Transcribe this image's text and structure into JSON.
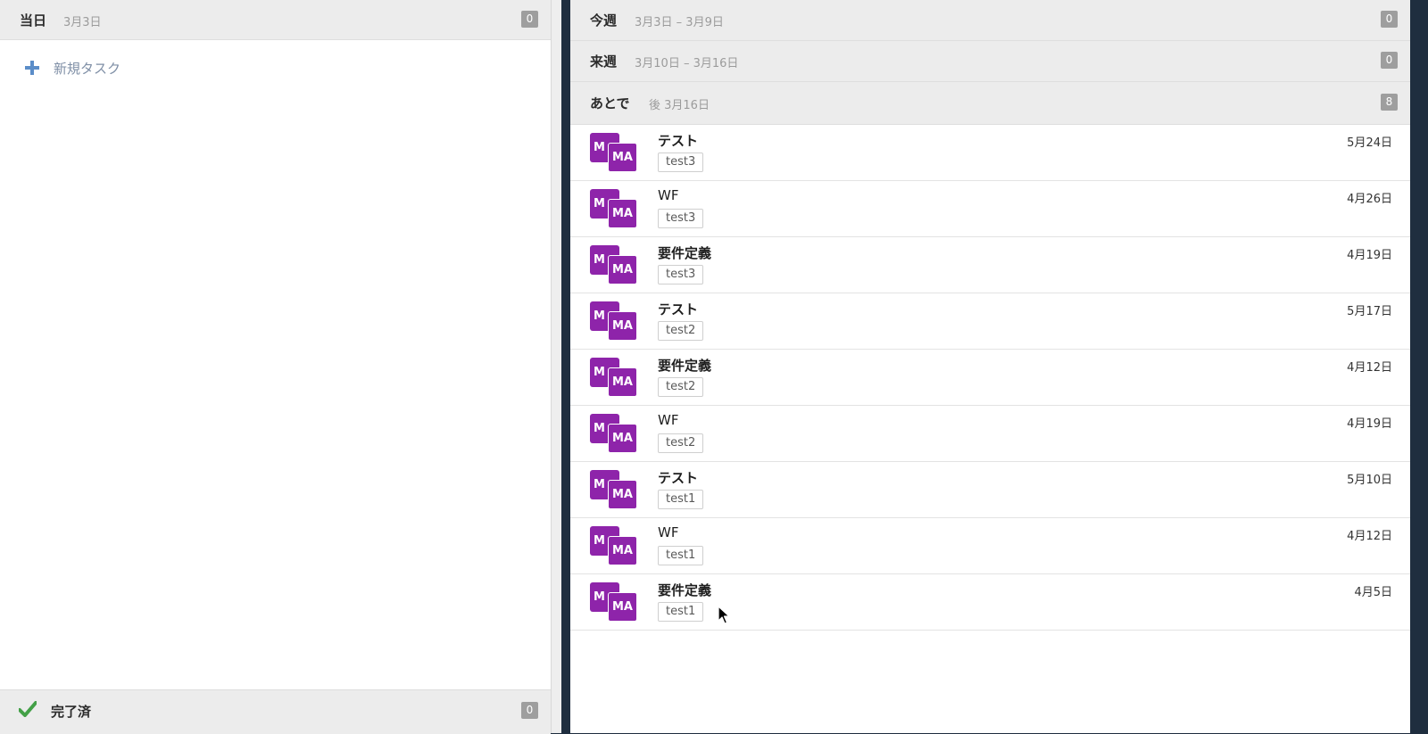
{
  "today": {
    "title": "当日",
    "date": "3月3日",
    "count": "0",
    "new_task_label": "新規タスク"
  },
  "done": {
    "title": "完了済",
    "count": "0"
  },
  "this_week": {
    "title": "今週",
    "range": "3月3日 – 3月9日",
    "count": "0"
  },
  "next_week": {
    "title": "来週",
    "range": "3月10日 – 3月16日",
    "count": "0"
  },
  "later": {
    "title": "あとで",
    "range": "後 3月16日",
    "count": "8"
  },
  "tasks": [
    {
      "title": "テスト",
      "project": "test3",
      "due": "5月24日",
      "avatar_back": "M",
      "avatar_front": "MA"
    },
    {
      "title": "WF",
      "project": "test3",
      "due": "4月26日",
      "avatar_back": "M",
      "avatar_front": "MA"
    },
    {
      "title": "要件定義",
      "project": "test3",
      "due": "4月19日",
      "avatar_back": "M",
      "avatar_front": "MA"
    },
    {
      "title": "テスト",
      "project": "test2",
      "due": "5月17日",
      "avatar_back": "M",
      "avatar_front": "MA"
    },
    {
      "title": "要件定義",
      "project": "test2",
      "due": "4月12日",
      "avatar_back": "M",
      "avatar_front": "MA"
    },
    {
      "title": "WF",
      "project": "test2",
      "due": "4月19日",
      "avatar_back": "M",
      "avatar_front": "MA"
    },
    {
      "title": "テスト",
      "project": "test1",
      "due": "5月10日",
      "avatar_back": "M",
      "avatar_front": "MA"
    },
    {
      "title": "WF",
      "project": "test1",
      "due": "4月12日",
      "avatar_back": "M",
      "avatar_front": "MA"
    },
    {
      "title": "要件定義",
      "project": "test1",
      "due": "4月5日",
      "avatar_back": "M",
      "avatar_front": "MA"
    }
  ],
  "colors": {
    "avatar": "#8e24aa",
    "accent": "#5b8dc8",
    "check": "#43a047",
    "badge": "#9e9e9e",
    "frame": "#1f2e3f"
  },
  "icons": {
    "new_task": "plus-icon",
    "done": "check-icon",
    "pointer": "cursor-icon"
  }
}
